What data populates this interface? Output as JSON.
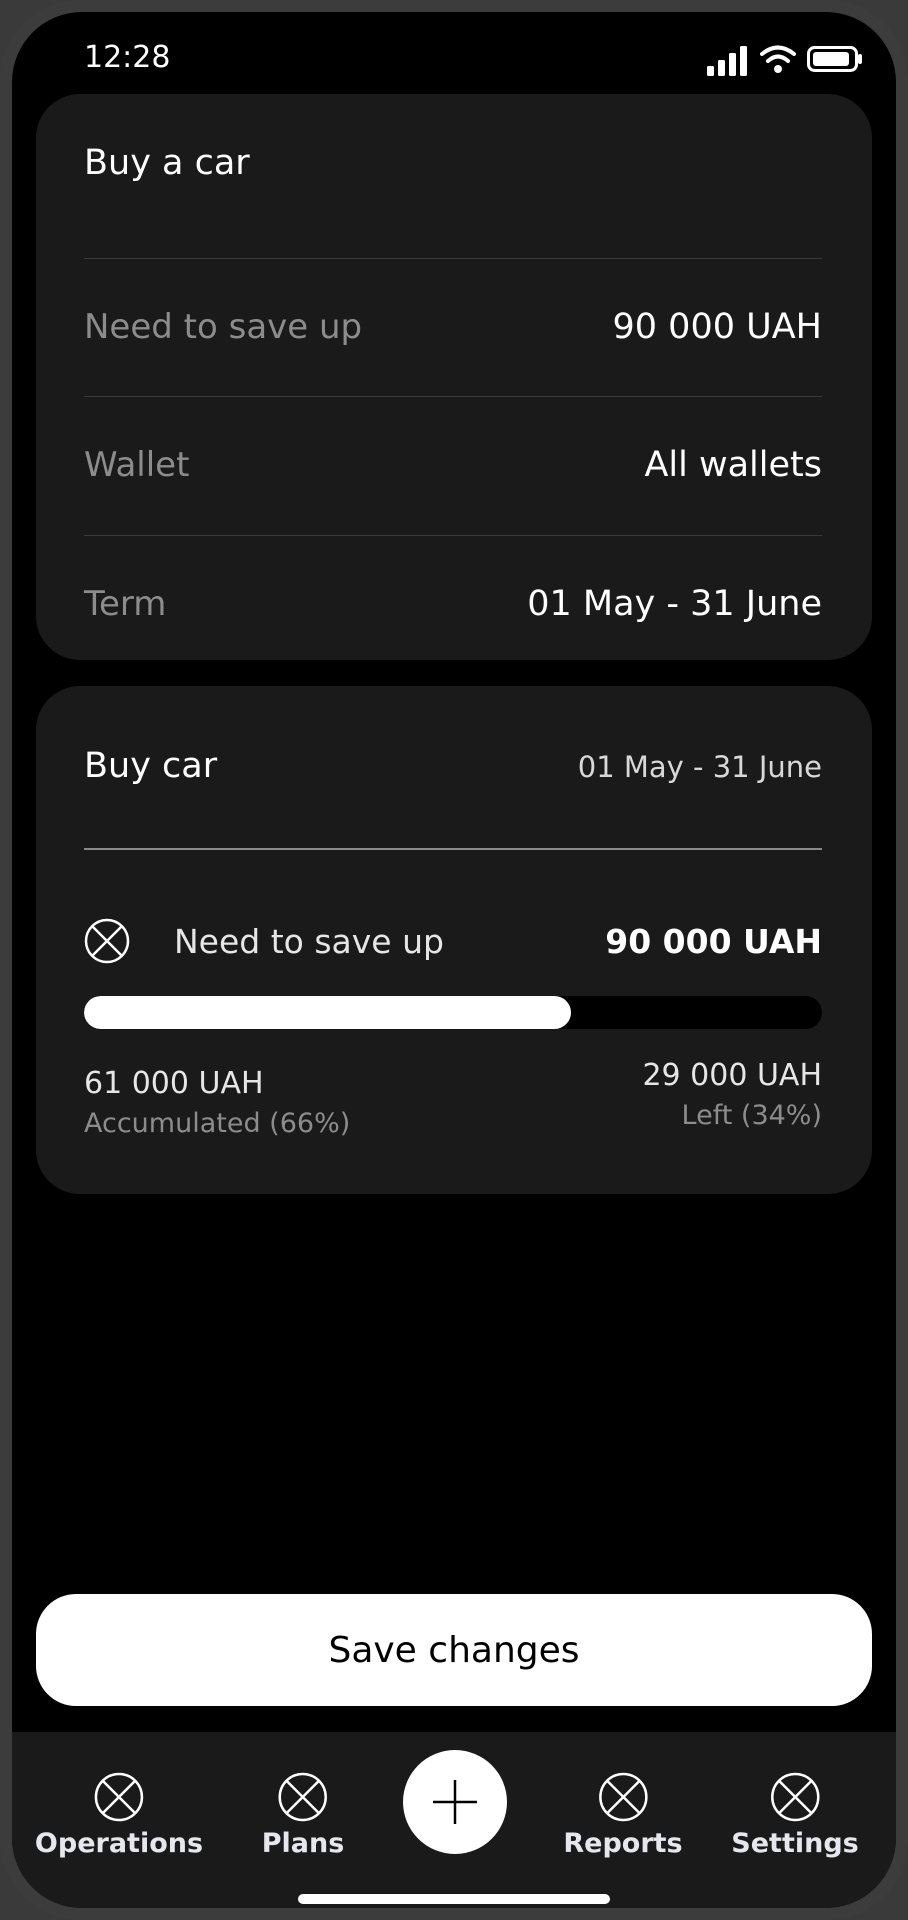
{
  "status_bar": {
    "time": "12:28"
  },
  "goal_card": {
    "title": "Buy a car",
    "rows": [
      {
        "label": "Need to save up",
        "value": "90 000 UAH"
      },
      {
        "label": "Wallet",
        "value": "All wallets"
      },
      {
        "label": "Term",
        "value": "01 May - 31 June"
      }
    ]
  },
  "progress_card": {
    "title": "Buy car",
    "date_range": "01 May - 31 June",
    "need_label": "Need to save up",
    "need_amount": "90 000 UAH",
    "progress_fraction": 0.66,
    "accumulated_amount": "61 000 UAH",
    "accumulated_label": "Accumulated (66%)",
    "left_amount": "29 000 UAH",
    "left_label": "Left (34%)"
  },
  "save_button": {
    "label": "Save changes"
  },
  "tab_bar": {
    "items": [
      {
        "label": "Operations",
        "icon": "circle-x-icon"
      },
      {
        "label": "Plans",
        "icon": "circle-x-icon"
      },
      {
        "label": "Reports",
        "icon": "circle-x-icon"
      },
      {
        "label": "Settings",
        "icon": "circle-x-icon"
      }
    ],
    "fab_icon": "plus-icon"
  },
  "colors": {
    "background": "#000000",
    "card": "#1a1a1a",
    "accent": "#ffffff",
    "muted": "#8c8c8c"
  }
}
